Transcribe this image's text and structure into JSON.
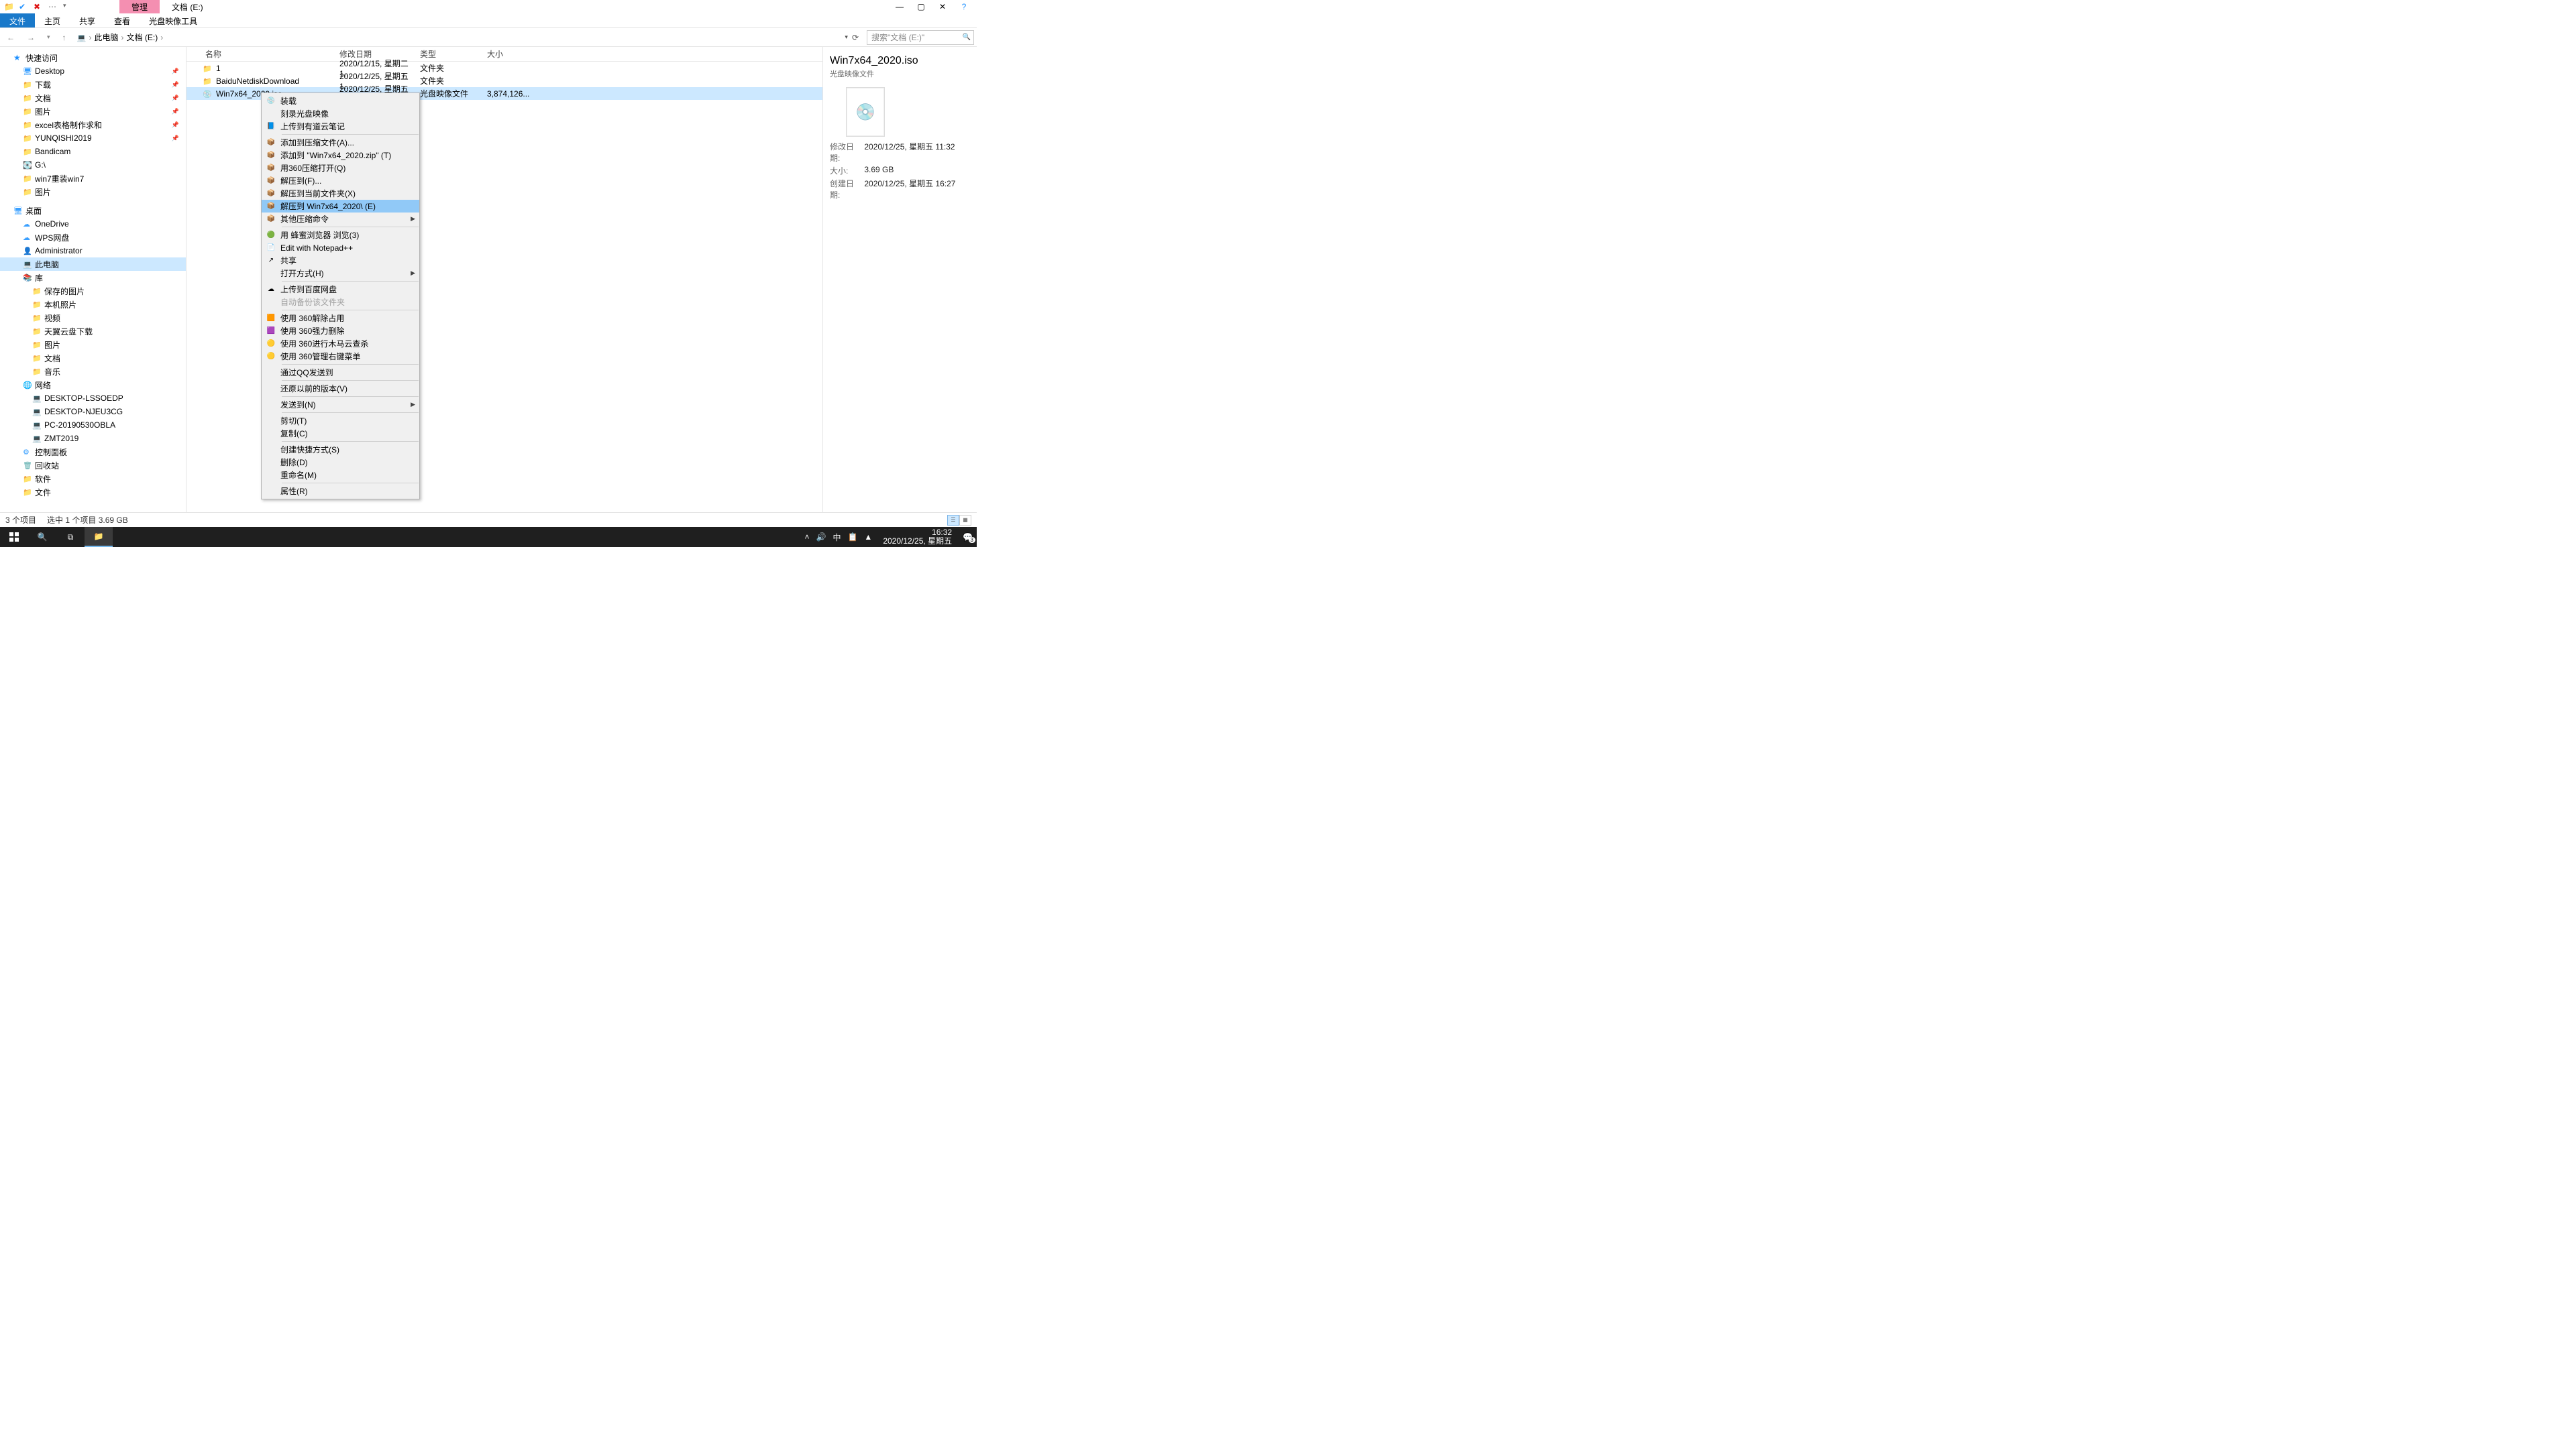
{
  "window": {
    "title_tabs": {
      "manage": "管理",
      "location": "文档 (E:)"
    }
  },
  "ribbon": {
    "file": "文件",
    "home": "主页",
    "share": "共享",
    "view": "查看",
    "isoTools": "光盘映像工具"
  },
  "breadcrumb": {
    "root": "此电脑",
    "drive": "文档 (E:)"
  },
  "search": {
    "placeholder": "搜索\"文档 (E:)\""
  },
  "nav": {
    "quick": "快速访问",
    "quick_items": [
      "Desktop",
      "下载",
      "文档",
      "图片",
      "excel表格制作求和",
      "YUNQISHI2019",
      "Bandicam",
      "G:\\",
      "win7重装win7",
      "图片"
    ],
    "desktop": "桌面",
    "desktop_items": [
      "OneDrive",
      "WPS网盘",
      "Administrator",
      "此电脑",
      "库"
    ],
    "lib_items": [
      "保存的图片",
      "本机照片",
      "视频",
      "天翼云盘下载",
      "图片",
      "文档",
      "音乐"
    ],
    "network": "网络",
    "net_items": [
      "DESKTOP-LSSOEDP",
      "DESKTOP-NJEU3CG",
      "PC-20190530OBLA",
      "ZMT2019"
    ],
    "misc": [
      "控制面板",
      "回收站",
      "软件",
      "文件"
    ]
  },
  "columns": {
    "name": "名称",
    "date": "修改日期",
    "type": "类型",
    "size": "大小"
  },
  "rows": [
    {
      "name": "1",
      "date": "2020/12/15, 星期二 1...",
      "type": "文件夹",
      "size": "",
      "icon": "folder"
    },
    {
      "name": "BaiduNetdiskDownload",
      "date": "2020/12/25, 星期五 1...",
      "type": "文件夹",
      "size": "",
      "icon": "folder"
    },
    {
      "name": "Win7x64_2020.iso",
      "date": "2020/12/25, 星期五 1...",
      "type": "光盘映像文件",
      "size": "3,874,126...",
      "icon": "iso",
      "selected": true
    }
  ],
  "context_menu": [
    {
      "label": "装载",
      "icon": "💿"
    },
    {
      "label": "刻录光盘映像"
    },
    {
      "label": "上传到有道云笔记",
      "icon": "📘"
    },
    {
      "sep": true
    },
    {
      "label": "添加到压缩文件(A)...",
      "icon": "📦"
    },
    {
      "label": "添加到 \"Win7x64_2020.zip\" (T)",
      "icon": "📦"
    },
    {
      "label": "用360压缩打开(Q)",
      "icon": "📦"
    },
    {
      "label": "解压到(F)...",
      "icon": "📦"
    },
    {
      "label": "解压到当前文件夹(X)",
      "icon": "📦"
    },
    {
      "label": "解压到 Win7x64_2020\\ (E)",
      "icon": "📦",
      "highlight": true
    },
    {
      "label": "其他压缩命令",
      "icon": "📦",
      "submenu": true
    },
    {
      "sep": true
    },
    {
      "label": "用 蜂蜜浏览器 浏览(3)",
      "icon": "🟢"
    },
    {
      "label": "Edit with Notepad++",
      "icon": "📄"
    },
    {
      "label": "共享",
      "icon": "↗"
    },
    {
      "label": "打开方式(H)",
      "submenu": true
    },
    {
      "sep": true
    },
    {
      "label": "上传到百度网盘",
      "icon": "☁"
    },
    {
      "label": "自动备份该文件夹",
      "disabled": true
    },
    {
      "sep": true
    },
    {
      "label": "使用 360解除占用",
      "icon": "🟧"
    },
    {
      "label": "使用 360强力删除",
      "icon": "🟪"
    },
    {
      "label": "使用 360进行木马云查杀",
      "icon": "🟡"
    },
    {
      "label": "使用 360管理右键菜单",
      "icon": "🟡"
    },
    {
      "sep": true
    },
    {
      "label": "通过QQ发送到"
    },
    {
      "sep": true
    },
    {
      "label": "还原以前的版本(V)"
    },
    {
      "sep": true
    },
    {
      "label": "发送到(N)",
      "submenu": true
    },
    {
      "sep": true
    },
    {
      "label": "剪切(T)"
    },
    {
      "label": "复制(C)"
    },
    {
      "sep": true
    },
    {
      "label": "创建快捷方式(S)"
    },
    {
      "label": "删除(D)"
    },
    {
      "label": "重命名(M)"
    },
    {
      "sep": true
    },
    {
      "label": "属性(R)"
    }
  ],
  "details": {
    "title": "Win7x64_2020.iso",
    "subtitle": "光盘映像文件",
    "meta": {
      "mod_label": "修改日期:",
      "mod_value": "2020/12/25, 星期五 11:32",
      "size_label": "大小:",
      "size_value": "3.69 GB",
      "created_label": "创建日期:",
      "created_value": "2020/12/25, 星期五 16:27"
    }
  },
  "status": {
    "count": "3 个项目",
    "selection": "选中 1 个项目  3.69 GB"
  },
  "taskbar": {
    "time": "16:32",
    "date": "2020/12/25, 星期五",
    "ime": "中",
    "badge": "3"
  }
}
